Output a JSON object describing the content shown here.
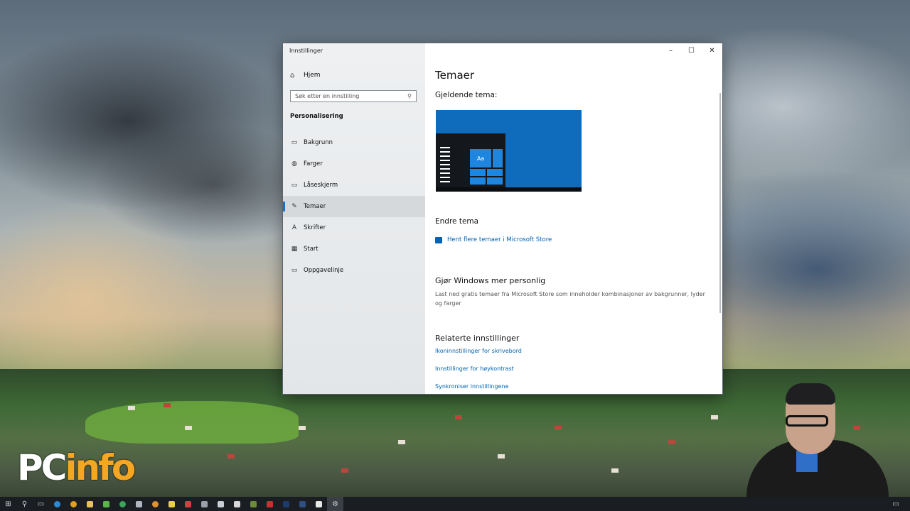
{
  "window": {
    "title": "Innstillinger",
    "minimize_label": "–",
    "maximize_label": "☐",
    "close_label": "✕"
  },
  "sidebar": {
    "home_label": "Hjem",
    "search_placeholder": "Søk etter en innstilling",
    "section_title": "Personalisering",
    "items": [
      {
        "label": "Bakgrunn",
        "icon": "image-icon"
      },
      {
        "label": "Farger",
        "icon": "palette-icon"
      },
      {
        "label": "Låseskjerm",
        "icon": "lockscreen-icon"
      },
      {
        "label": "Temaer",
        "icon": "brush-icon",
        "selected": true
      },
      {
        "label": "Skrifter",
        "icon": "font-icon"
      },
      {
        "label": "Start",
        "icon": "start-icon"
      },
      {
        "label": "Oppgavelinje",
        "icon": "taskbar-icon"
      }
    ]
  },
  "content": {
    "title": "Temaer",
    "current_theme_label": "Gjeldende tema:",
    "preview_tile_text": "Aa",
    "change_theme_label": "Endre tema",
    "store_link": "Hent flere temaer i Microsoft Store",
    "personalize_heading": "Gjør Windows mer personlig",
    "personalize_desc": "Last ned gratis temaer fra Microsoft Store som inneholder kombinasjoner av bakgrunner, lyder og farger",
    "related_heading": "Relaterte innstillinger",
    "related_links": [
      "Ikoninnstillinger for skrivebord",
      "Innstillinger for høykontrast",
      "Synkroniser innstillingene"
    ]
  },
  "overlay": {
    "logo_text_pc": "PC",
    "logo_text_info": "info"
  },
  "colors": {
    "accent": "#0063b1",
    "theme_preview": "#0f6cbd",
    "taskbar": "#1a1d22"
  }
}
